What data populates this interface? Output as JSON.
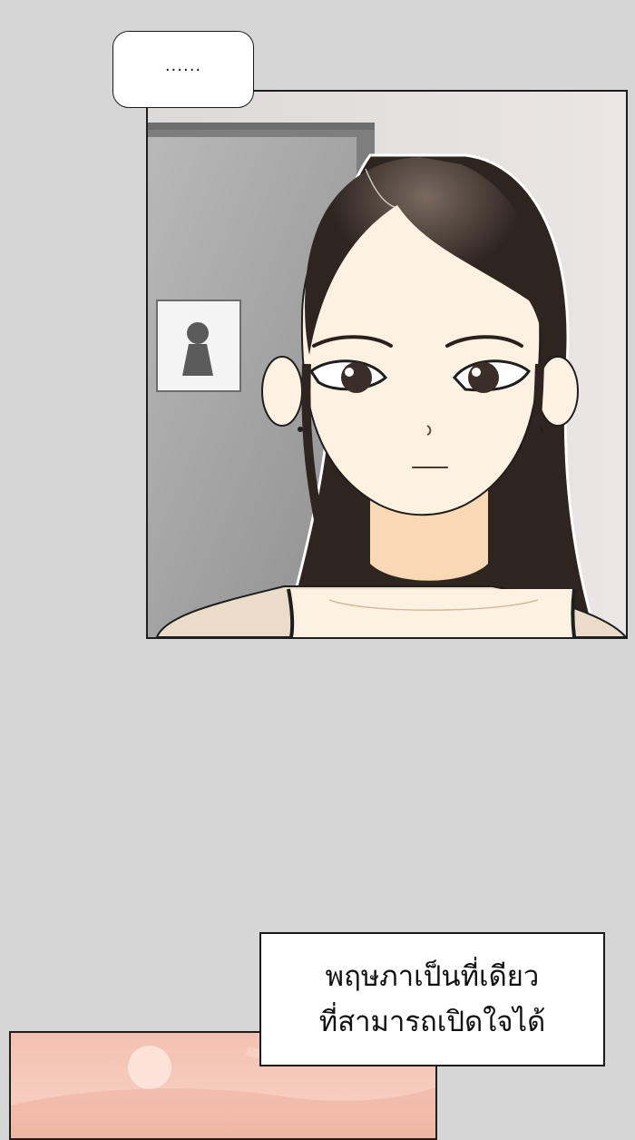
{
  "speech_bubble": {
    "text": "......"
  },
  "caption": {
    "line1": "พฤษภาเป็นที่เดียว",
    "line2": "ที่สามารถเปิดใจได้"
  },
  "colors": {
    "page_background": "#d6d6d6",
    "panel_border": "#1e1e1e",
    "hair": "#2e2520",
    "skin": "#fdf1e2",
    "door": "#9a9a9a",
    "bottom_panel": "#f3c0b0"
  },
  "icons": {
    "door_sign": "restroom-sign-icon"
  }
}
